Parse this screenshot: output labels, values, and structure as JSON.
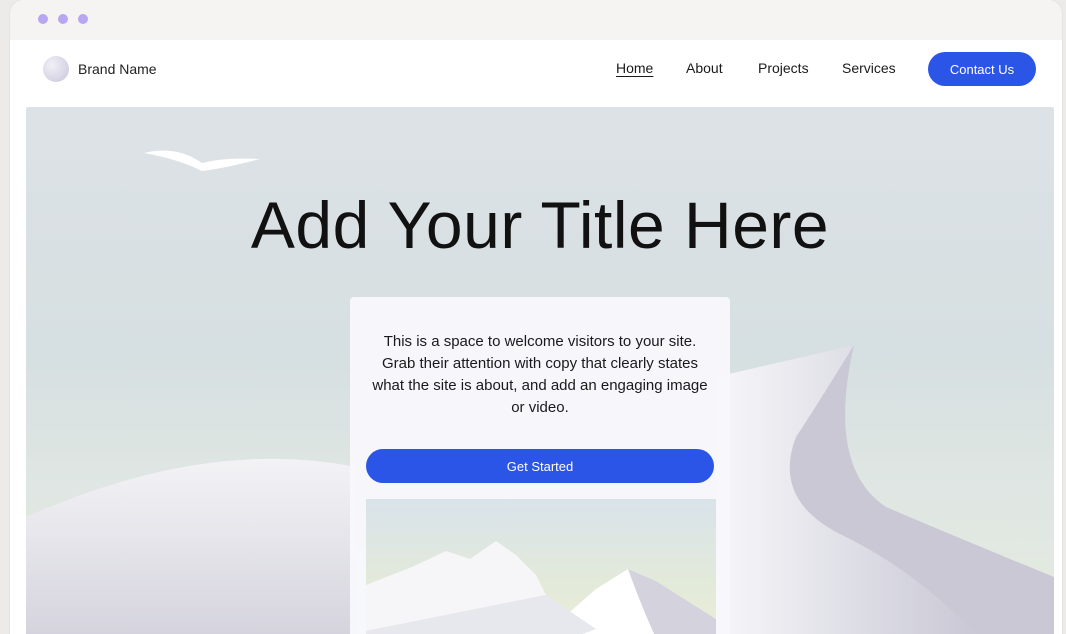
{
  "window": {
    "controls": [
      "dot",
      "dot",
      "dot"
    ]
  },
  "nav": {
    "brand_name": "Brand Name",
    "links": [
      "Home",
      "About",
      "Projects",
      "Services"
    ],
    "active_link": "Home",
    "contact_label": "Contact Us"
  },
  "hero": {
    "title": "Add Your Title Here",
    "body": "This is a space to welcome visitors to your site. Grab their attention with copy that clearly states what the site is about, and add an engaging image or video.",
    "cta_label": "Get Started"
  },
  "colors": {
    "accent": "#2b55e6",
    "window_dots": "#b7a7f0"
  }
}
